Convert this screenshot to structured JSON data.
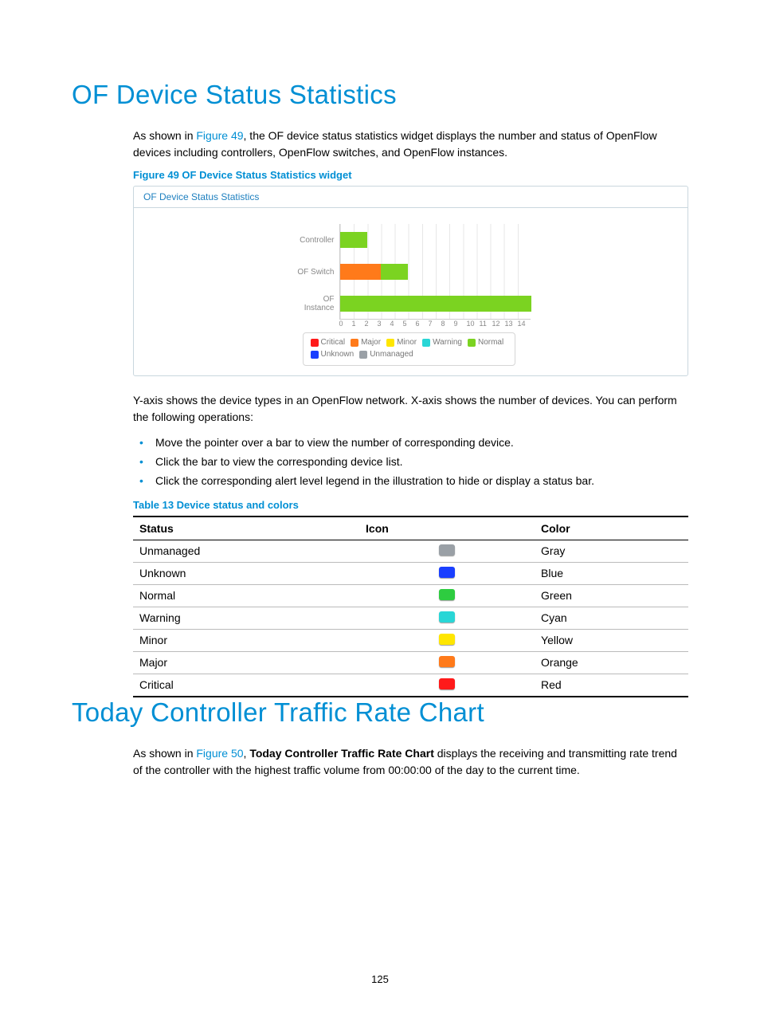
{
  "page_number": "125",
  "heading1": "OF Device Status Statistics",
  "intro1_a": "As shown in ",
  "intro1_link": "Figure 49",
  "intro1_b": ", the OF device status statistics widget displays the number and status of OpenFlow devices including controllers, OpenFlow switches, and OpenFlow instances.",
  "figure_caption": "Figure 49 OF Device Status Statistics widget",
  "figure_header": "OF Device Status Statistics",
  "para2": "Y-axis shows the device types in an OpenFlow network. X-axis shows the number of devices. You can perform the following operations:",
  "bullets": [
    "Move the pointer over a bar to view the number of corresponding device.",
    "Click the bar to view the corresponding device list.",
    "Click the corresponding alert level legend in the illustration to hide or display a status bar."
  ],
  "table_caption": "Table 13 Device status and colors",
  "table_headers": {
    "c1": "Status",
    "c2": "Icon",
    "c3": "Color"
  },
  "status_rows": [
    {
      "status": "Unmanaged",
      "color_name": "Gray",
      "hex": "#9aa0a6"
    },
    {
      "status": "Unknown",
      "color_name": "Blue",
      "hex": "#1a3fff"
    },
    {
      "status": "Normal",
      "color_name": "Green",
      "hex": "#2ecc40"
    },
    {
      "status": "Warning",
      "color_name": "Cyan",
      "hex": "#29d6d6"
    },
    {
      "status": "Minor",
      "color_name": "Yellow",
      "hex": "#ffe600"
    },
    {
      "status": "Major",
      "color_name": "Orange",
      "hex": "#ff7a1a"
    },
    {
      "status": "Critical",
      "color_name": "Red",
      "hex": "#ff1a1a"
    }
  ],
  "heading2": "Today Controller Traffic Rate Chart",
  "intro2_a": "As shown in ",
  "intro2_link": "Figure 50",
  "intro2_b": ", ",
  "intro2_bold": "Today Controller Traffic Rate Chart",
  "intro2_c": " displays the receiving and transmitting rate trend of the controller with the highest traffic volume from 00:00:00 of the day to the current time.",
  "chart_data": {
    "type": "bar",
    "orientation": "horizontal",
    "stacked": true,
    "xlabel": "",
    "ylabel": "",
    "xlim": [
      0,
      14
    ],
    "x_ticks": [
      "0",
      "1",
      "2",
      "3",
      "4",
      "5",
      "6",
      "7",
      "8",
      "9",
      "10",
      "11",
      "12",
      "13",
      "14"
    ],
    "categories": [
      "Controller",
      "OF Switch",
      "OF Instance"
    ],
    "segment_order": [
      "Critical",
      "Major",
      "Minor",
      "Warning",
      "Normal",
      "Unknown",
      "Unmanaged"
    ],
    "series": [
      {
        "name": "Critical",
        "color": "#ff1a1a",
        "values": [
          0,
          0,
          0
        ]
      },
      {
        "name": "Major",
        "color": "#ff7a1a",
        "values": [
          0,
          3,
          0
        ]
      },
      {
        "name": "Minor",
        "color": "#ffe600",
        "values": [
          0,
          0,
          0
        ]
      },
      {
        "name": "Warning",
        "color": "#29d6d6",
        "values": [
          0,
          0,
          0
        ]
      },
      {
        "name": "Normal",
        "color": "#7bd321",
        "values": [
          2,
          2,
          14
        ]
      },
      {
        "name": "Unknown",
        "color": "#1a3fff",
        "values": [
          0,
          0,
          0
        ]
      },
      {
        "name": "Unmanaged",
        "color": "#9aa0a6",
        "values": [
          0,
          0,
          0
        ]
      }
    ],
    "legend_order": [
      "Critical",
      "Major",
      "Minor",
      "Warning",
      "Normal",
      "Unknown",
      "Unmanaged"
    ]
  }
}
